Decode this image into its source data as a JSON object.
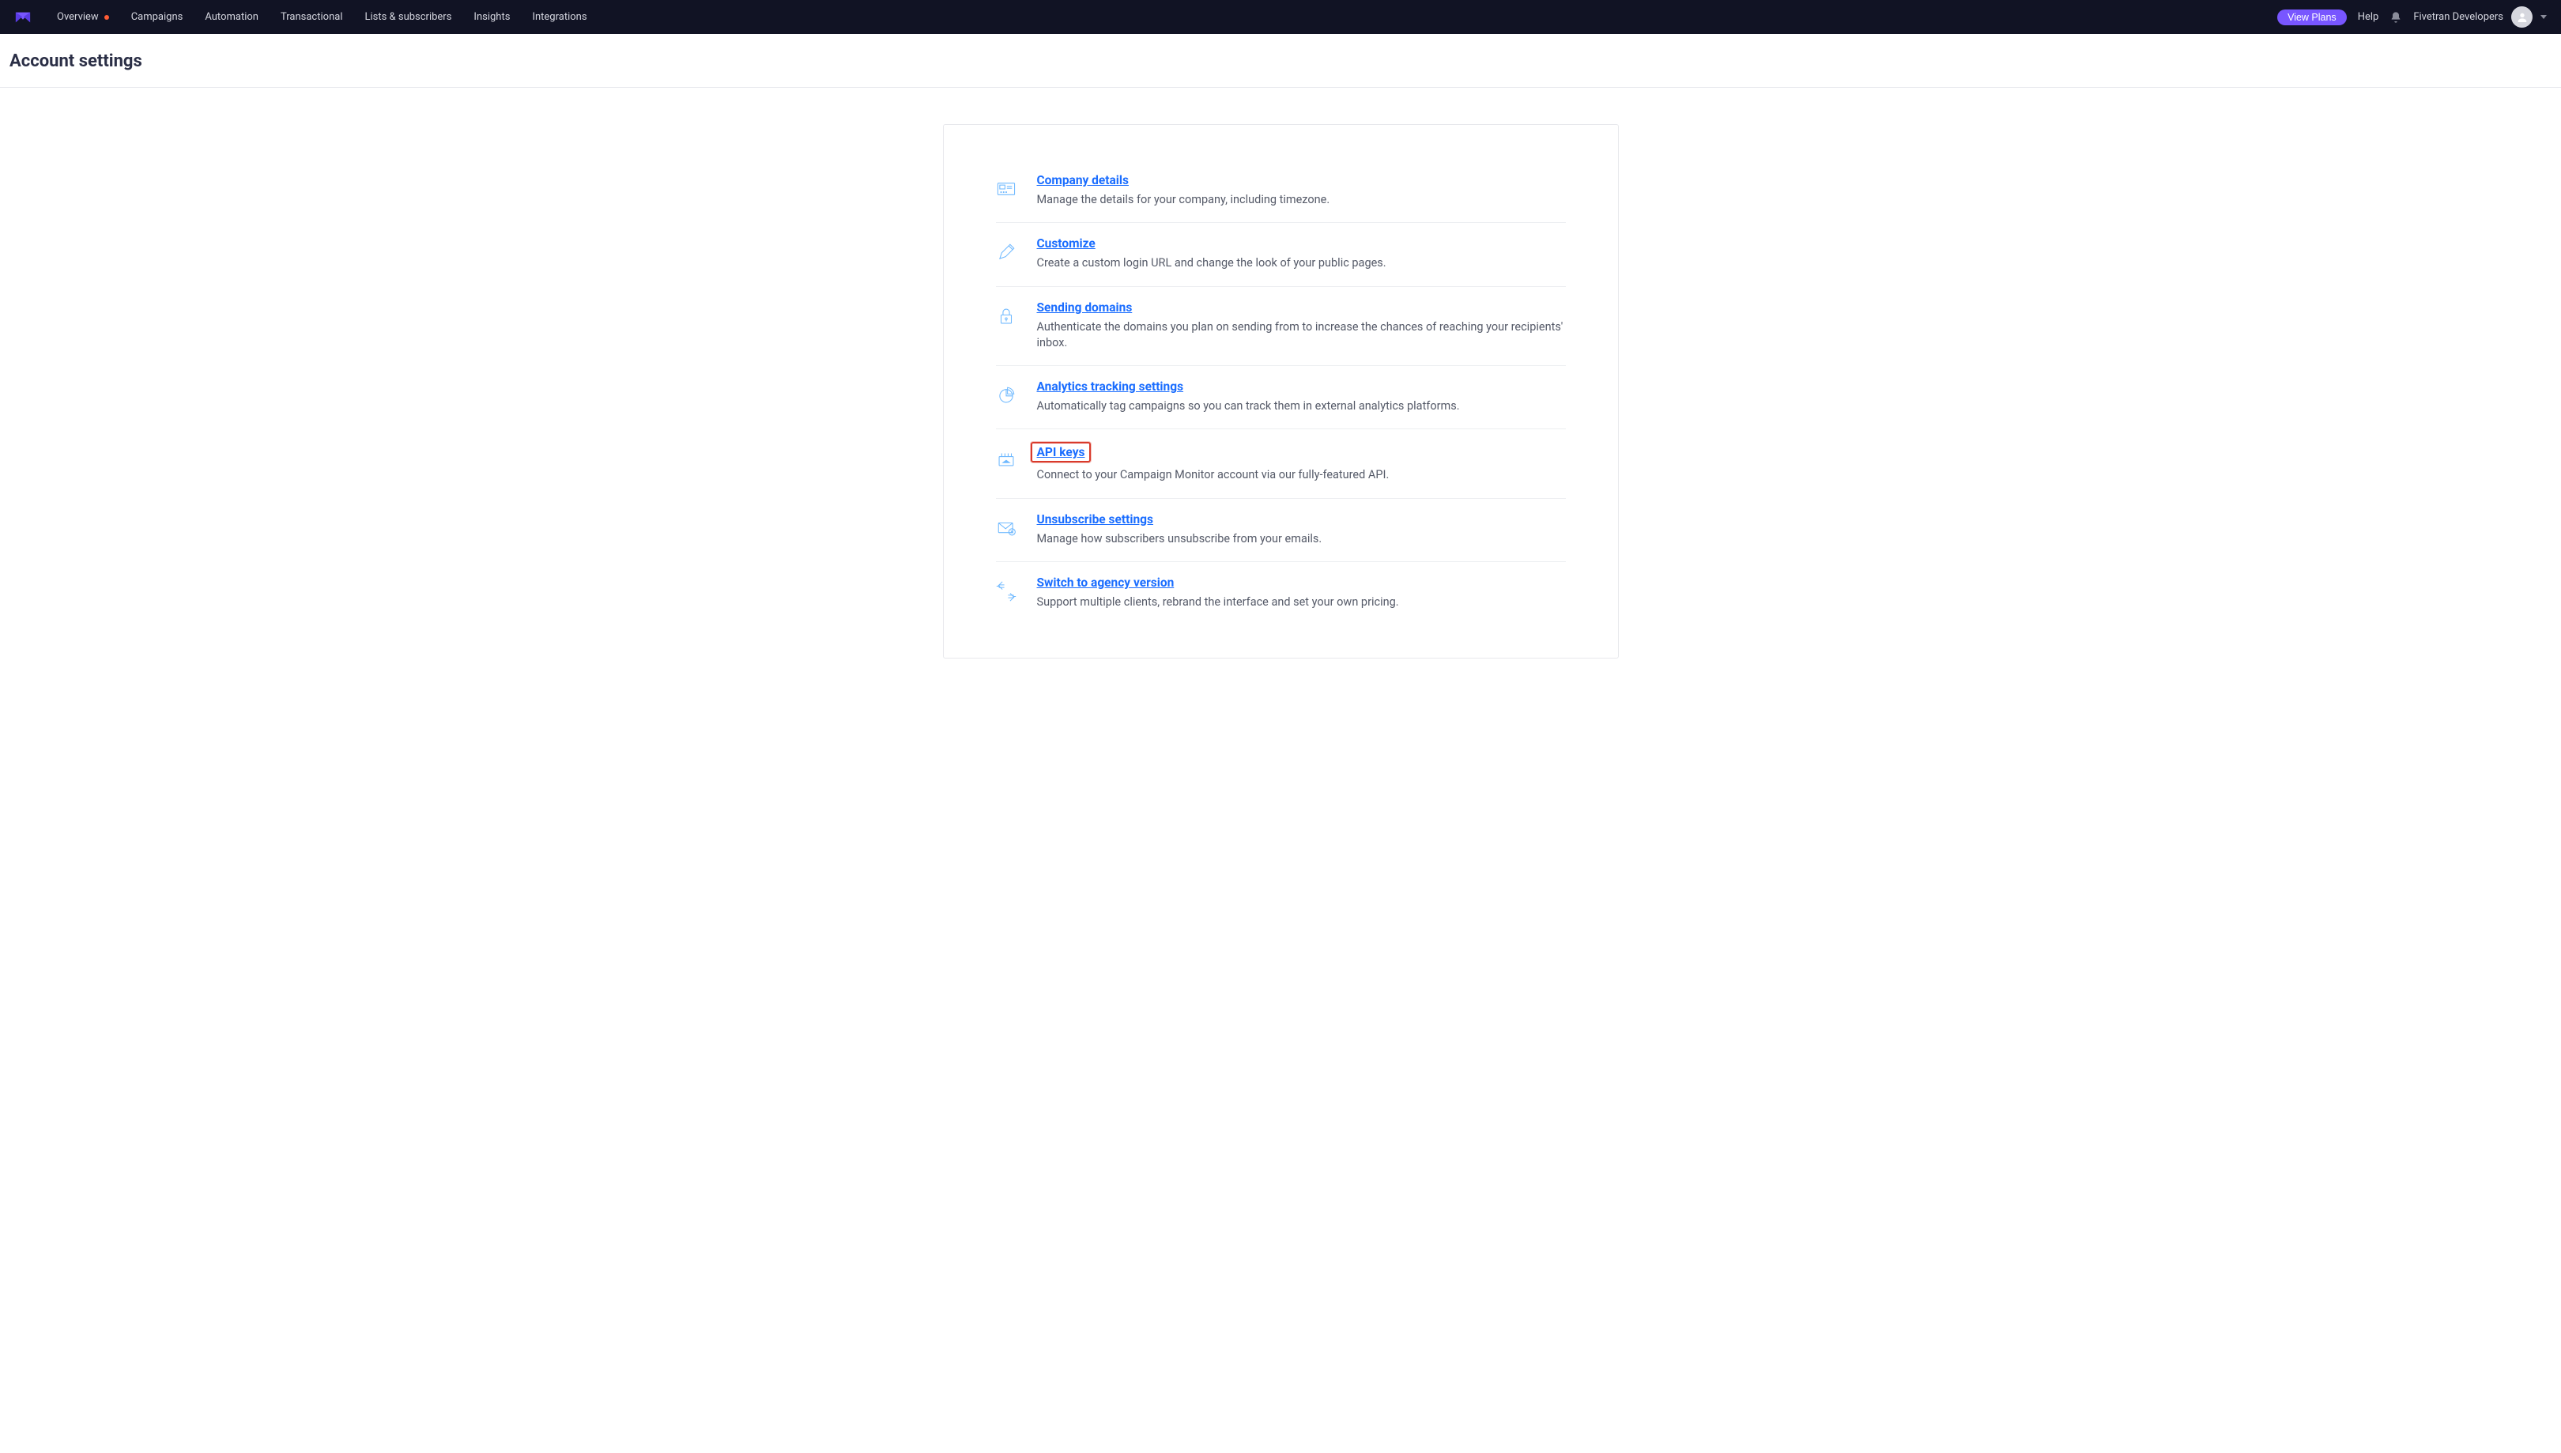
{
  "nav": {
    "items": [
      "Overview",
      "Campaigns",
      "Automation",
      "Transactional",
      "Lists & subscribers",
      "Insights",
      "Integrations"
    ]
  },
  "topbar": {
    "view_plans": "View Plans",
    "help": "Help",
    "user_name": "Fivetran Developers"
  },
  "page": {
    "title": "Account settings"
  },
  "settings": [
    {
      "title": "Company details",
      "desc": "Manage the details for your company, including timezone."
    },
    {
      "title": "Customize",
      "desc": "Create a custom login URL and change the look of your public pages."
    },
    {
      "title": "Sending domains",
      "desc": "Authenticate the domains you plan on sending from to increase the chances of reaching your recipients' inbox."
    },
    {
      "title": "Analytics tracking settings",
      "desc": "Automatically tag campaigns so you can track them in external analytics platforms."
    },
    {
      "title": "API keys",
      "desc": "Connect to your Campaign Monitor account via our fully-featured API."
    },
    {
      "title": "Unsubscribe settings",
      "desc": "Manage how subscribers unsubscribe from your emails."
    },
    {
      "title": "Switch to agency version",
      "desc": "Support multiple clients, rebrand the interface and set your own pricing."
    }
  ]
}
